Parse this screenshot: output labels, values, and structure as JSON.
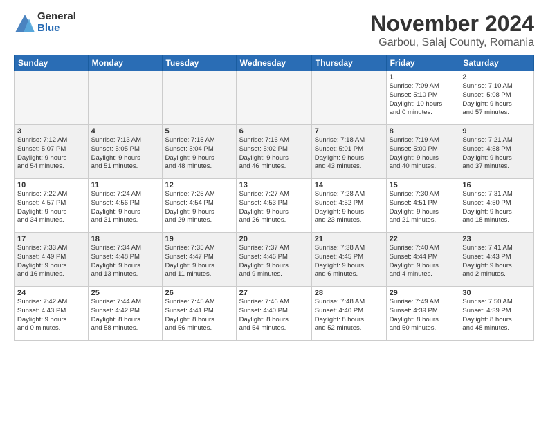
{
  "logo": {
    "general": "General",
    "blue": "Blue"
  },
  "title": {
    "month": "November 2024",
    "location": "Garbou, Salaj County, Romania"
  },
  "headers": [
    "Sunday",
    "Monday",
    "Tuesday",
    "Wednesday",
    "Thursday",
    "Friday",
    "Saturday"
  ],
  "weeks": [
    [
      {
        "day": "",
        "info": ""
      },
      {
        "day": "",
        "info": ""
      },
      {
        "day": "",
        "info": ""
      },
      {
        "day": "",
        "info": ""
      },
      {
        "day": "",
        "info": ""
      },
      {
        "day": "1",
        "info": "Sunrise: 7:09 AM\nSunset: 5:10 PM\nDaylight: 10 hours\nand 0 minutes."
      },
      {
        "day": "2",
        "info": "Sunrise: 7:10 AM\nSunset: 5:08 PM\nDaylight: 9 hours\nand 57 minutes."
      }
    ],
    [
      {
        "day": "3",
        "info": "Sunrise: 7:12 AM\nSunset: 5:07 PM\nDaylight: 9 hours\nand 54 minutes."
      },
      {
        "day": "4",
        "info": "Sunrise: 7:13 AM\nSunset: 5:05 PM\nDaylight: 9 hours\nand 51 minutes."
      },
      {
        "day": "5",
        "info": "Sunrise: 7:15 AM\nSunset: 5:04 PM\nDaylight: 9 hours\nand 48 minutes."
      },
      {
        "day": "6",
        "info": "Sunrise: 7:16 AM\nSunset: 5:02 PM\nDaylight: 9 hours\nand 46 minutes."
      },
      {
        "day": "7",
        "info": "Sunrise: 7:18 AM\nSunset: 5:01 PM\nDaylight: 9 hours\nand 43 minutes."
      },
      {
        "day": "8",
        "info": "Sunrise: 7:19 AM\nSunset: 5:00 PM\nDaylight: 9 hours\nand 40 minutes."
      },
      {
        "day": "9",
        "info": "Sunrise: 7:21 AM\nSunset: 4:58 PM\nDaylight: 9 hours\nand 37 minutes."
      }
    ],
    [
      {
        "day": "10",
        "info": "Sunrise: 7:22 AM\nSunset: 4:57 PM\nDaylight: 9 hours\nand 34 minutes."
      },
      {
        "day": "11",
        "info": "Sunrise: 7:24 AM\nSunset: 4:56 PM\nDaylight: 9 hours\nand 31 minutes."
      },
      {
        "day": "12",
        "info": "Sunrise: 7:25 AM\nSunset: 4:54 PM\nDaylight: 9 hours\nand 29 minutes."
      },
      {
        "day": "13",
        "info": "Sunrise: 7:27 AM\nSunset: 4:53 PM\nDaylight: 9 hours\nand 26 minutes."
      },
      {
        "day": "14",
        "info": "Sunrise: 7:28 AM\nSunset: 4:52 PM\nDaylight: 9 hours\nand 23 minutes."
      },
      {
        "day": "15",
        "info": "Sunrise: 7:30 AM\nSunset: 4:51 PM\nDaylight: 9 hours\nand 21 minutes."
      },
      {
        "day": "16",
        "info": "Sunrise: 7:31 AM\nSunset: 4:50 PM\nDaylight: 9 hours\nand 18 minutes."
      }
    ],
    [
      {
        "day": "17",
        "info": "Sunrise: 7:33 AM\nSunset: 4:49 PM\nDaylight: 9 hours\nand 16 minutes."
      },
      {
        "day": "18",
        "info": "Sunrise: 7:34 AM\nSunset: 4:48 PM\nDaylight: 9 hours\nand 13 minutes."
      },
      {
        "day": "19",
        "info": "Sunrise: 7:35 AM\nSunset: 4:47 PM\nDaylight: 9 hours\nand 11 minutes."
      },
      {
        "day": "20",
        "info": "Sunrise: 7:37 AM\nSunset: 4:46 PM\nDaylight: 9 hours\nand 9 minutes."
      },
      {
        "day": "21",
        "info": "Sunrise: 7:38 AM\nSunset: 4:45 PM\nDaylight: 9 hours\nand 6 minutes."
      },
      {
        "day": "22",
        "info": "Sunrise: 7:40 AM\nSunset: 4:44 PM\nDaylight: 9 hours\nand 4 minutes."
      },
      {
        "day": "23",
        "info": "Sunrise: 7:41 AM\nSunset: 4:43 PM\nDaylight: 9 hours\nand 2 minutes."
      }
    ],
    [
      {
        "day": "24",
        "info": "Sunrise: 7:42 AM\nSunset: 4:43 PM\nDaylight: 9 hours\nand 0 minutes."
      },
      {
        "day": "25",
        "info": "Sunrise: 7:44 AM\nSunset: 4:42 PM\nDaylight: 8 hours\nand 58 minutes."
      },
      {
        "day": "26",
        "info": "Sunrise: 7:45 AM\nSunset: 4:41 PM\nDaylight: 8 hours\nand 56 minutes."
      },
      {
        "day": "27",
        "info": "Sunrise: 7:46 AM\nSunset: 4:40 PM\nDaylight: 8 hours\nand 54 minutes."
      },
      {
        "day": "28",
        "info": "Sunrise: 7:48 AM\nSunset: 4:40 PM\nDaylight: 8 hours\nand 52 minutes."
      },
      {
        "day": "29",
        "info": "Sunrise: 7:49 AM\nSunset: 4:39 PM\nDaylight: 8 hours\nand 50 minutes."
      },
      {
        "day": "30",
        "info": "Sunrise: 7:50 AM\nSunset: 4:39 PM\nDaylight: 8 hours\nand 48 minutes."
      }
    ]
  ]
}
